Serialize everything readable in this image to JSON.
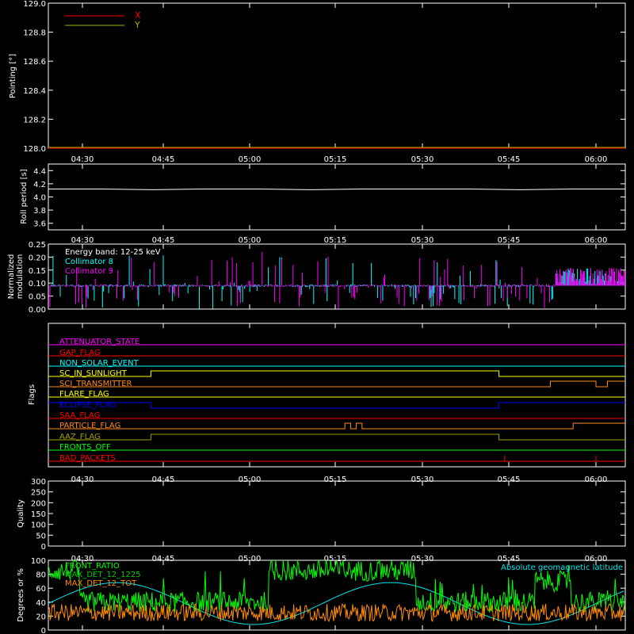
{
  "time_ticks": [
    "04:30",
    "04:45",
    "05:00",
    "05:15",
    "05:30",
    "05:45",
    "06:00"
  ],
  "chart_data": [
    {
      "type": "line",
      "ylabel": "Pointing [°]",
      "ylim": [
        128.0,
        129.0
      ],
      "yticks": [
        "128.0",
        "128.2",
        "128.4",
        "128.6",
        "128.8",
        "129.0"
      ],
      "legend": "top-left",
      "series": [
        {
          "name": "X",
          "color": "#ff0000",
          "values": [
            128.0,
            128.0
          ]
        },
        {
          "name": "Y",
          "color": "#b0b000",
          "values": [
            128.0,
            128.0
          ]
        }
      ]
    },
    {
      "type": "line",
      "ylabel": "Roll period [s]",
      "ylim": [
        3.5,
        4.5
      ],
      "yticks": [
        "3.6",
        "3.8",
        "4.0",
        "4.2",
        "4.4"
      ],
      "series": [
        {
          "color": "#ffffff",
          "values": [
            4.12,
            4.12,
            4.11,
            4.12,
            4.12,
            4.11,
            4.12,
            4.12,
            4.12,
            4.11,
            4.12,
            4.12
          ]
        }
      ]
    },
    {
      "type": "line",
      "ylabel": "Normalized modulation",
      "ylim": [
        0.0,
        0.25
      ],
      "yticks": [
        "0.00",
        "0.05",
        "0.10",
        "0.15",
        "0.20",
        "0.25"
      ],
      "annotation": "Energy band: 12-25 keV",
      "series": [
        {
          "name": "Collimator 8",
          "color": "#00ffff",
          "baseline": 0.09
        },
        {
          "name": "Collimator 9",
          "color": "#ff00ff",
          "baseline": 0.09
        }
      ]
    },
    {
      "type": "line",
      "ylabel": "Flags",
      "series": [
        {
          "name": "ATTENUATOR_STATE",
          "color": "#ff00ff",
          "state_changes": []
        },
        {
          "name": "GAP_FLAG",
          "color": "#ff0000",
          "state_changes": []
        },
        {
          "name": "NON_SOLAR_EVENT",
          "color": "#00ffff",
          "state_changes": []
        },
        {
          "name": "SC_IN_SUNLIGHT",
          "color": "#ffff00",
          "state_changes": [
            "04:42",
            "05:43"
          ]
        },
        {
          "name": "SCI_TRANSMITTER",
          "color": "#ff8c1a",
          "state_changes": [
            "05:52",
            "06:00",
            "06:02"
          ]
        },
        {
          "name": "FLARE_FLAG",
          "color": "#ffff00",
          "state_changes": []
        },
        {
          "name": "ECLIPSE_FLAG",
          "color": "#0000ff",
          "state_changes": [
            "04:42",
            "05:43"
          ]
        },
        {
          "name": "SAA_FLAG",
          "color": "#ff0000",
          "state_changes": []
        },
        {
          "name": "PARTICLE_FLAG",
          "color": "#ff8c1a",
          "state_changes": [
            "05:16",
            "05:17",
            "05:18",
            "05:19",
            "05:56"
          ]
        },
        {
          "name": "AAZ_FLAG",
          "color": "#a0a000",
          "state_changes": [
            "04:42",
            "05:43"
          ]
        },
        {
          "name": "FRONTS_OFF",
          "color": "#00ff00",
          "state_changes": []
        },
        {
          "name": "BAD_PACKETS",
          "color": "#ff0000",
          "state_changes": [
            "05:44",
            "06:00"
          ]
        }
      ]
    },
    {
      "type": "line",
      "ylabel": "Quality",
      "ylim": [
        0,
        300
      ],
      "yticks": [
        "0",
        "50",
        "100",
        "150",
        "200",
        "250",
        "300"
      ],
      "series": [
        {
          "color": "#ffffff",
          "values": [
            0,
            0
          ]
        }
      ]
    },
    {
      "type": "line",
      "ylabel": "Degrees or %",
      "ylim": [
        0,
        100
      ],
      "yticks": [
        "0",
        "20",
        "40",
        "60",
        "80",
        "100"
      ],
      "series": [
        {
          "name": "FRONT_RATIO",
          "color": "#00ff00"
        },
        {
          "name": "MAX_DET_12_1225",
          "color": "#00c800"
        },
        {
          "name": "MAX_DET_12_TOT",
          "color": "#ff8c00"
        },
        {
          "name": "Absolute geomagnetic latitude",
          "color": "#00e5ee"
        }
      ]
    }
  ]
}
